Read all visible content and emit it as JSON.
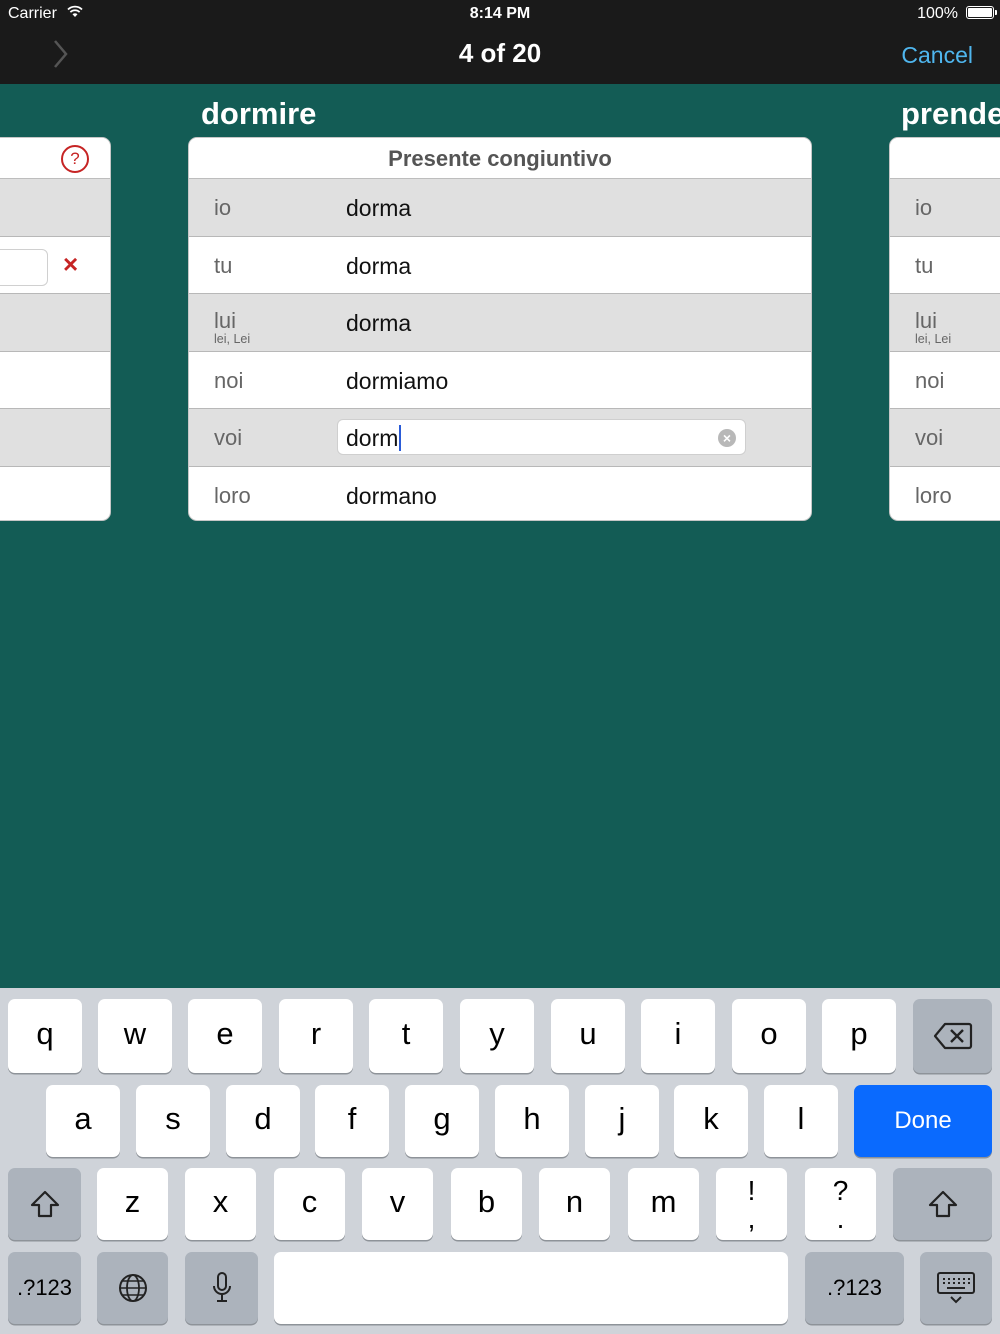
{
  "status": {
    "carrier": "Carrier",
    "time": "8:14 PM",
    "battery": "100%"
  },
  "nav": {
    "title": "4 of 20",
    "cancel": "Cancel"
  },
  "verbs": {
    "current": "dormire",
    "next": "prende"
  },
  "table": {
    "header": "Presente congiuntivo",
    "rows": [
      {
        "pronoun": "io",
        "sub": "",
        "form": "dorma"
      },
      {
        "pronoun": "tu",
        "sub": "",
        "form": "dorma"
      },
      {
        "pronoun": "lui",
        "sub": "lei, Lei",
        "form": "dorma"
      },
      {
        "pronoun": "noi",
        "sub": "",
        "form": "dormiamo"
      },
      {
        "pronoun": "voi",
        "sub": "",
        "form": "dorm"
      },
      {
        "pronoun": "loro",
        "sub": "",
        "form": "dormano"
      }
    ]
  },
  "left_card": {
    "help": "?",
    "wrong_mark": "×"
  },
  "keyboard": {
    "row1": [
      "q",
      "w",
      "e",
      "r",
      "t",
      "y",
      "u",
      "i",
      "o",
      "p"
    ],
    "row2": [
      "a",
      "s",
      "d",
      "f",
      "g",
      "h",
      "j",
      "k",
      "l"
    ],
    "done": "Done",
    "row3": [
      "z",
      "x",
      "c",
      "v",
      "b",
      "n",
      "m"
    ],
    "punct1_top": "!",
    "punct1_bottom": ",",
    "punct2_top": "?",
    "punct2_bottom": ".",
    "numbers": ".?123",
    "accent": "#0a6afe"
  }
}
